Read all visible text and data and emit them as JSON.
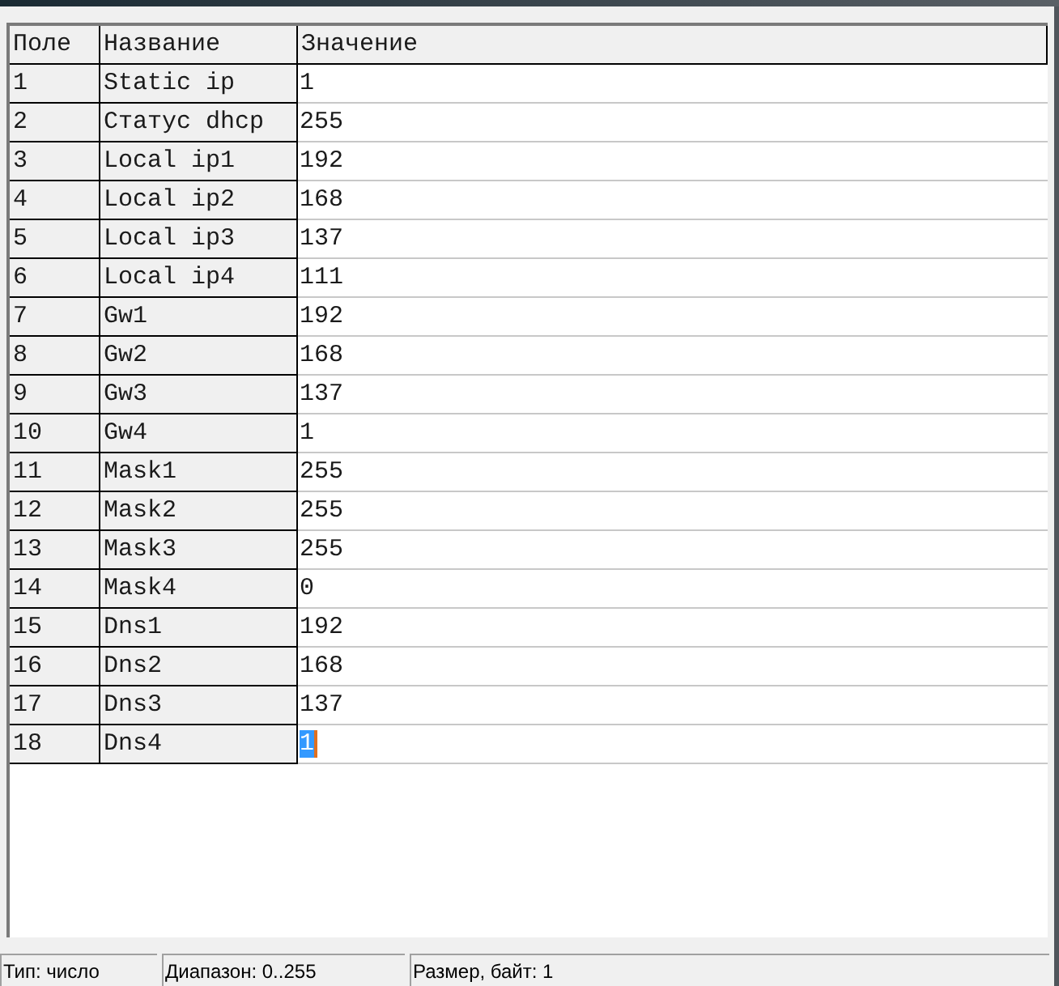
{
  "table": {
    "columns": [
      "Поле",
      "Название",
      "Значение"
    ],
    "rows": [
      {
        "field": "1",
        "name": "Static ip",
        "value": "1",
        "selected": false
      },
      {
        "field": "2",
        "name": "Статус dhcp",
        "value": "255",
        "selected": false
      },
      {
        "field": "3",
        "name": "Local ip1",
        "value": "192",
        "selected": false
      },
      {
        "field": "4",
        "name": "Local ip2",
        "value": "168",
        "selected": false
      },
      {
        "field": "5",
        "name": "Local ip3",
        "value": "137",
        "selected": false
      },
      {
        "field": "6",
        "name": "Local ip4",
        "value": "111",
        "selected": false
      },
      {
        "field": "7",
        "name": "Gw1",
        "value": "192",
        "selected": false
      },
      {
        "field": "8",
        "name": "Gw2",
        "value": "168",
        "selected": false
      },
      {
        "field": "9",
        "name": "Gw3",
        "value": "137",
        "selected": false
      },
      {
        "field": "10",
        "name": "Gw4",
        "value": "1",
        "selected": false
      },
      {
        "field": "11",
        "name": "Mask1",
        "value": "255",
        "selected": false
      },
      {
        "field": "12",
        "name": "Mask2",
        "value": "255",
        "selected": false
      },
      {
        "field": "13",
        "name": "Mask3",
        "value": "255",
        "selected": false
      },
      {
        "field": "14",
        "name": "Mask4",
        "value": "0",
        "selected": false
      },
      {
        "field": "15",
        "name": "Dns1",
        "value": "192",
        "selected": false
      },
      {
        "field": "16",
        "name": "Dns2",
        "value": "168",
        "selected": false
      },
      {
        "field": "17",
        "name": "Dns3",
        "value": "137",
        "selected": false
      },
      {
        "field": "18",
        "name": "Dns4",
        "value": "1",
        "selected": true
      }
    ]
  },
  "status_bar": [
    "Тип: число",
    "Диапазон: 0..255",
    "Размер, байт: 1"
  ]
}
